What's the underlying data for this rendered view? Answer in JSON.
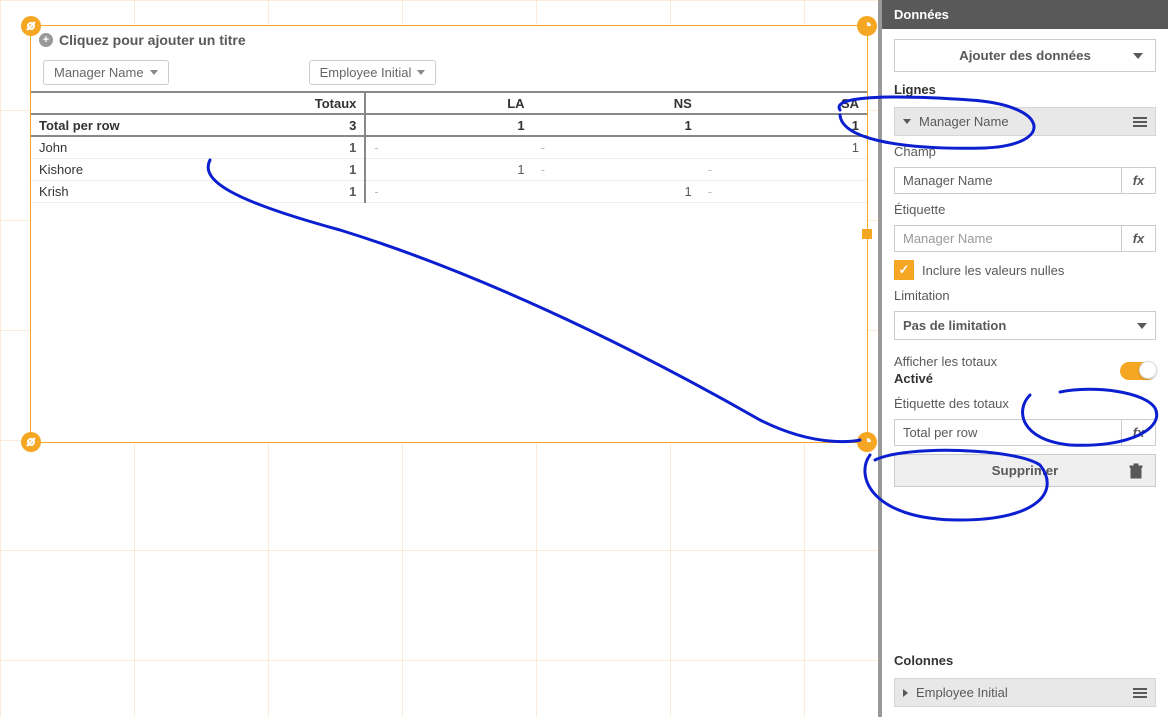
{
  "panel": {
    "header": "Données",
    "addData": "Ajouter des données",
    "rowsSection": "Lignes",
    "managerAccordion": "Manager Name",
    "champLabel": "Champ",
    "champValue": "Manager Name",
    "etiquetteLabel": "Étiquette",
    "etiquettePlaceholder": "Manager Name",
    "includeNulls": "Inclure les valeurs nulles",
    "limitationLabel": "Limitation",
    "limitationValue": "Pas de limitation",
    "showTotalsLabel": "Afficher les totaux",
    "toggleStatus": "Activé",
    "totalsLabelLabel": "Étiquette des totaux",
    "totalsLabelValue": "Total per row",
    "deleteBtn": "Supprimer",
    "colsSection": "Colonnes",
    "employeeAccordion": "Employee Initial"
  },
  "chart": {
    "titlePlaceholder": "Cliquez pour ajouter un titre",
    "dim1": "Manager Name",
    "dim2": "Employee Initial"
  },
  "chart_data": {
    "type": "table",
    "column_headers": [
      "",
      "Totaux",
      "LA",
      "NS",
      "SA"
    ],
    "rows": [
      {
        "label": "Total per row",
        "totaux": 3,
        "LA": 1,
        "NS": 1,
        "SA": 1,
        "is_total": true
      },
      {
        "label": "John",
        "totaux": 1,
        "LA": "-",
        "NS": "-",
        "SA": 1
      },
      {
        "label": "Kishore",
        "totaux": 1,
        "LA": 1,
        "NS": "-",
        "SA": "-"
      },
      {
        "label": "Krish",
        "totaux": 1,
        "LA": "-",
        "NS": 1,
        "SA": "-"
      }
    ]
  }
}
